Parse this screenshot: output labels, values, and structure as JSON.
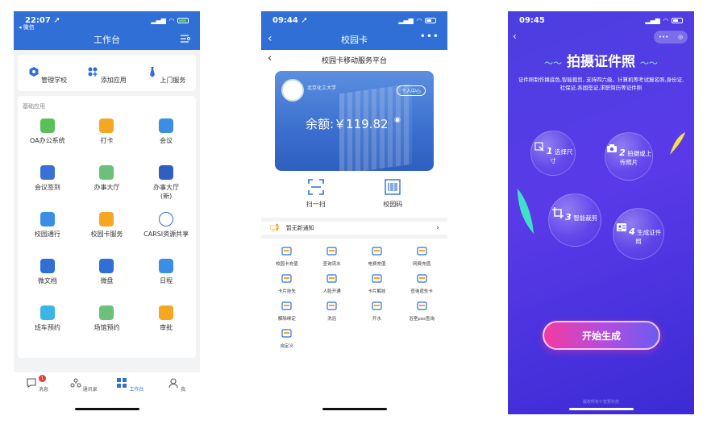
{
  "phone1": {
    "status": {
      "time": "22:07 ➚",
      "back_app": "◂ 微信"
    },
    "title": "工作台",
    "quick": [
      {
        "label": "管理学校",
        "icon": "hexagon-icon"
      },
      {
        "label": "添加应用",
        "icon": "apps-add-icon"
      },
      {
        "label": "上门服务",
        "icon": "tie-icon"
      }
    ],
    "section_label": "基础应用",
    "apps": [
      {
        "label": "OA办公系统",
        "icon": "edit-icon",
        "color": "#5ac05a"
      },
      {
        "label": "打卡",
        "icon": "location-pin-icon",
        "color": "#f5a623"
      },
      {
        "label": "会议",
        "icon": "cloud-icon",
        "color": "#3a8ee6"
      },
      {
        "label": "会议签到",
        "icon": "meeting-checkin-icon",
        "color": "#3a6fd6"
      },
      {
        "label": "办事大厅",
        "icon": "building-icon",
        "color": "#6cc07a"
      },
      {
        "label": "办事大厅\n(新)",
        "icon": "monitor-icon",
        "color": "#2f5fbf"
      },
      {
        "label": "校园通行",
        "icon": "campus-pass-icon",
        "color": "#3a8ee6"
      },
      {
        "label": "校园卡服务",
        "icon": "card-icon",
        "color": "#f5a623"
      },
      {
        "label": "CARSI资源共享",
        "icon": "carsi-globe-icon",
        "color": "#ffffff"
      },
      {
        "label": "微文档",
        "icon": "word-doc-icon",
        "color": "#2f6fd6"
      },
      {
        "label": "微盘",
        "icon": "cloud-drive-icon",
        "color": "#2f6fd6"
      },
      {
        "label": "日程",
        "icon": "calendar-icon",
        "color": "#3a8ee6"
      },
      {
        "label": "班车预约",
        "icon": "bus-icon",
        "color": "#3ab5e6"
      },
      {
        "label": "场馆预约",
        "icon": "badminton-icon",
        "color": "#6cc07a"
      },
      {
        "label": "审批",
        "icon": "approval-stamp-icon",
        "color": "#f5a623"
      }
    ],
    "tabs": [
      {
        "label": "消息",
        "icon": "chat-icon",
        "badge": "1"
      },
      {
        "label": "通讯录",
        "icon": "contacts-icon"
      },
      {
        "label": "工作台",
        "icon": "workbench-icon",
        "active": true
      },
      {
        "label": "我",
        "icon": "person-icon"
      }
    ]
  },
  "phone2": {
    "status": {
      "time": "09:44 ➚"
    },
    "title": "校园卡",
    "subtitle": "校园卡移动服务平台",
    "card": {
      "school": "北京化工大学",
      "personal_center": "个人中心",
      "balance": "余额:￥119.82"
    },
    "scan": [
      {
        "label": "扫一扫",
        "icon": "scan-icon"
      },
      {
        "label": "校园码",
        "icon": "barcode-icon"
      }
    ],
    "notice": "暂无新通知",
    "services": [
      {
        "label": "校园卡充值",
        "icon": "card-topup-icon"
      },
      {
        "label": "查询流水",
        "icon": "search-record-icon"
      },
      {
        "label": "电费充值",
        "icon": "bulb-icon"
      },
      {
        "label": "网费充值",
        "icon": "globe-icon"
      },
      {
        "label": "卡片挂失",
        "icon": "card-lost-icon"
      },
      {
        "label": "人脸开通",
        "icon": "face-id-icon"
      },
      {
        "label": "卡片解挂",
        "icon": "card-unlock-icon"
      },
      {
        "label": "查询遗失卡",
        "icon": "search-card-icon"
      },
      {
        "label": "解除绑定",
        "icon": "unlink-icon"
      },
      {
        "label": "洗浴",
        "icon": "bathtub-icon"
      },
      {
        "label": "开水",
        "icon": "water-icon"
      },
      {
        "label": "浴室pos查询",
        "icon": "bath-pos-icon"
      },
      {
        "label": "自定义",
        "icon": "grid-custom-icon"
      }
    ]
  },
  "phone3": {
    "status": {
      "time": "09:45"
    },
    "heading": "拍摄证件照",
    "description": "证件照制作换底色,智能裁剪, 支持四六级、计算机等考试报名照,身份证,社保证,各国签证,求职简历等证件照",
    "steps": [
      {
        "num": "1",
        "label": "选择尺寸",
        "icon": "select-size-icon"
      },
      {
        "num": "2",
        "label": "拍摄或上\n传照片",
        "icon": "camera-icon"
      },
      {
        "num": "3",
        "label": "智能裁剪",
        "icon": "crop-icon"
      },
      {
        "num": "4",
        "label": "生成证件照",
        "icon": "id-card-icon"
      }
    ],
    "start_button": "开始生成",
    "footer": "版权所有©智慧科技"
  }
}
